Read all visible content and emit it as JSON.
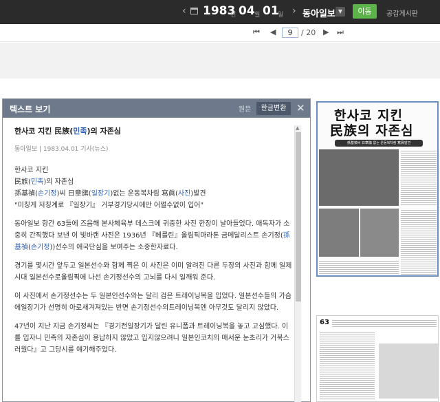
{
  "header": {
    "year": "1983",
    "year_unit": "년",
    "month": "04",
    "month_unit": "월",
    "day": "01",
    "day_unit": "일",
    "newspaper": "동아일보",
    "go_label": "이동",
    "board_label": "공감게시판",
    "icons": [
      "chevron-left-icon",
      "calendar-icon",
      "chevron-right-icon",
      "dropdown-icon"
    ]
  },
  "pager": {
    "first": "⏮",
    "prev": "◀",
    "current_page": "9",
    "total": "/ 20",
    "next": "▶",
    "last": "⏭"
  },
  "panel": {
    "title": "텍스트 보기",
    "tab_original": "원문",
    "tab_korean": "한글변환",
    "close": "✕",
    "article_title_pre": "한사코 지킨 民族(",
    "article_title_hl": "민족",
    "article_title_post": ")의 자존심",
    "meta": "동아일보 | 1983.04.01 기사(뉴스)",
    "lines": {
      "l1": "한사코 지킨",
      "l2_pre": "民族(",
      "l2_hl": "민족",
      "l2_post": ")의 자존심",
      "l3_a": "孫基禎(",
      "l3_b": "손기정",
      "l3_c": ")씨 日章旗(",
      "l3_d": "일장기",
      "l3_e": ")없는 운동복차림 寫眞(",
      "l3_f": "사진",
      "l3_g": ")발견",
      "l4": "\"미칭게 저칭계로 『일장기』 거부경기당시에만 어쩔수없이 입어\""
    },
    "para1": " 동아일보 항간 63들에 즈음해 본사체육부 데스크에 귀중한 사진 한장이 날아들었다. 애독자가 소중히 간직했다 보낸 이 빛바랜 사진은 1936년 『베를린』올림픽마라톤 금메달리스트 손기정(",
    "para1_hl1": "孫基禎",
    "para1_mid": "(",
    "para1_hl2": "손기정",
    "para1_post": "))선수의 애국단심을 보여주는 소중한자료다.",
    "para2": " 경기를 몇시간 앞두고 일본선수와 함께 찍은 이 사진은 이미 알려진 다른 두장의 사진과 함께 일제시대 일본선수로올림픽에 나선 손기정선수의 고뇌를 다시 일깨워 준다.",
    "para3": " 이 사진에서 손기정선수는 두 일본인선수와는 달리 검은 트레이닝복을 입었다. 일본선수들의 가슴에일장기가 선명히 아로새겨져있는 반면 손기정선수의트레이닝복엔 아무것도 달리지 않았다.",
    "para4": " 47년이 지난 지금 손기정씨는 『경기전일장기가 달린 유니폼과 트레이닝복을 놓고 고심했다. 이를 입자니 민족의 자존심이 용납하지 않았고 입지않으려니 일본인코치의 매서운 눈초리가 거북스러웠다』고 그당시를 얘기해주었다."
  },
  "thumbnail": {
    "headline1": "한사코 지킨",
    "headline2": "民族의 자존심",
    "subhead": "孫基禎씨 日章旗 없는 운동복차림 寫眞발견",
    "page_no": "63"
  }
}
